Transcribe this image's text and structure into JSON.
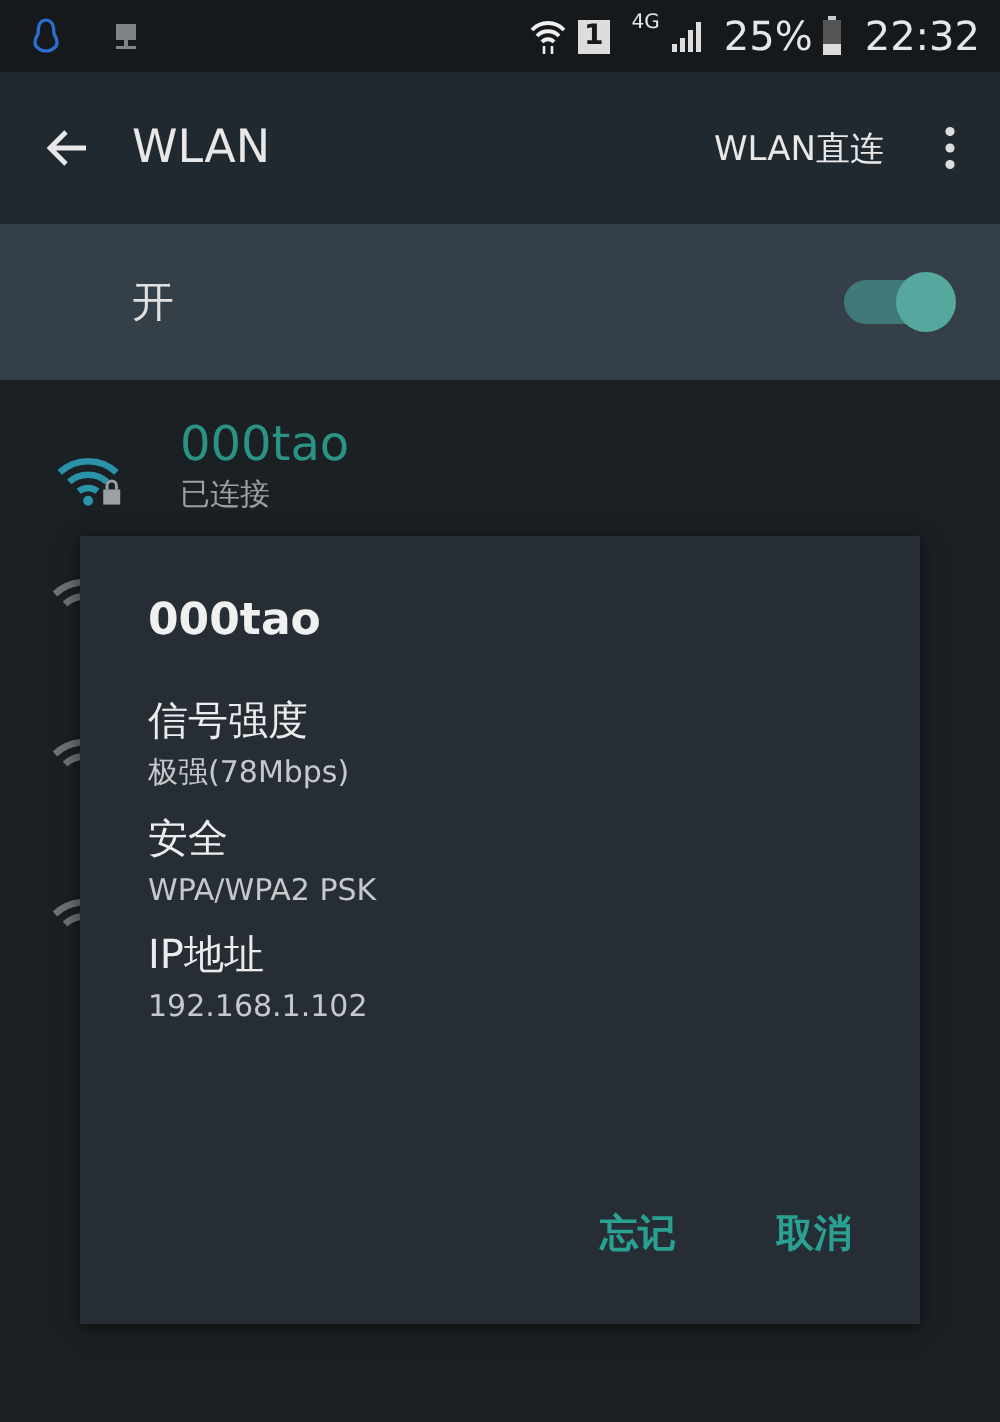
{
  "status_bar": {
    "battery": "25%",
    "time": "22:32",
    "network": "4G",
    "sim": "1"
  },
  "toolbar": {
    "title": "WLAN",
    "action": "WLAN直连"
  },
  "master_switch": {
    "label": "开",
    "on": true
  },
  "networks": [
    {
      "name": "000tao",
      "status": "已连接",
      "connected": true
    }
  ],
  "partly_hidden_networks": [
    {
      "kind": "wifi"
    },
    {
      "kind": "wifi"
    },
    {
      "kind": "wifi"
    }
  ],
  "dialog": {
    "title": "000tao",
    "fields": [
      {
        "label": "信号强度",
        "value": "极强(78Mbps)"
      },
      {
        "label": "安全",
        "value": "WPA/WPA2 PSK"
      },
      {
        "label": "IP地址",
        "value": "192.168.1.102"
      }
    ],
    "buttons": [
      "忘记",
      "取消"
    ]
  }
}
